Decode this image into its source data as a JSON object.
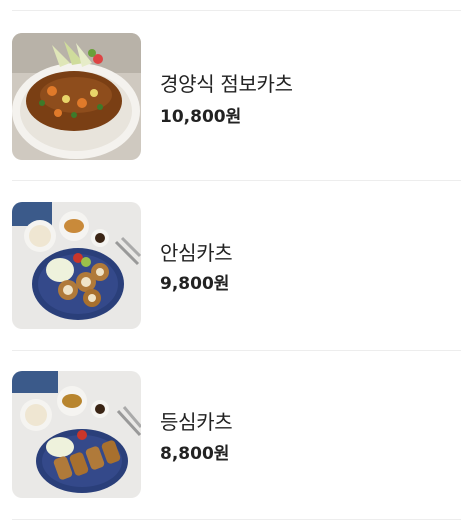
{
  "menu": {
    "items": [
      {
        "name": "경양식 점보카츠",
        "price": "10,800원",
        "image": "jumbo-katsu-photo"
      },
      {
        "name": "안심카츠",
        "price": "9,800원",
        "image": "tenderloin-katsu-photo"
      },
      {
        "name": "등심카츠",
        "price": "8,800원",
        "image": "pork-loin-katsu-photo"
      }
    ]
  }
}
